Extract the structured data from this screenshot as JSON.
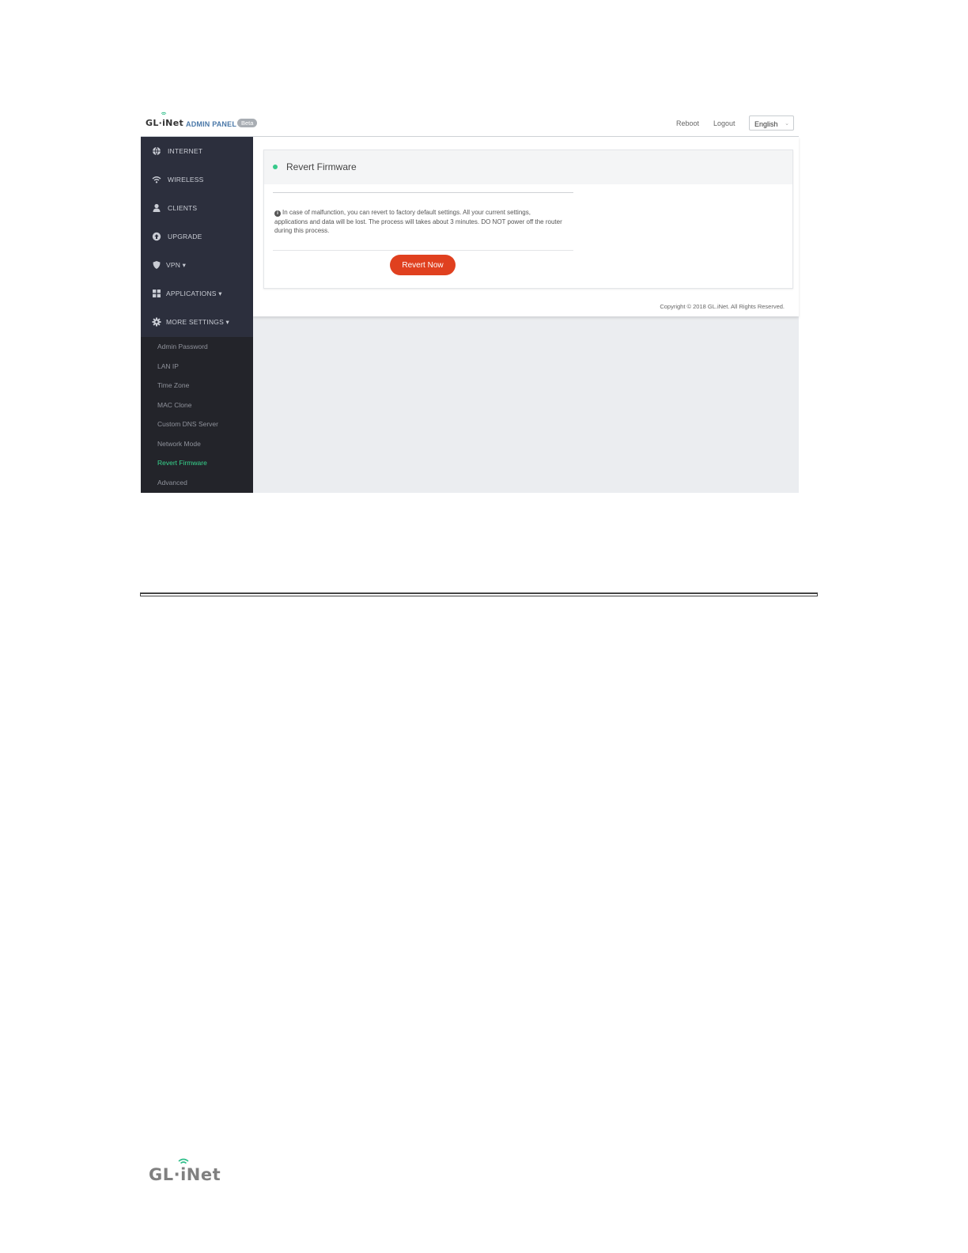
{
  "header": {
    "brand": "GL·iNet",
    "panel_label": "ADMIN PANEL",
    "badge": "Beta",
    "reboot": "Reboot",
    "logout": "Logout",
    "language": "English"
  },
  "sidebar": {
    "items": [
      {
        "label": "INTERNET",
        "icon": "globe-icon"
      },
      {
        "label": "WIRELESS",
        "icon": "wifi-icon"
      },
      {
        "label": "CLIENTS",
        "icon": "user-icon"
      },
      {
        "label": "UPGRADE",
        "icon": "upload-icon"
      },
      {
        "label": "VPN ▾",
        "icon": "shield-icon"
      },
      {
        "label": "APPLICATIONS ▾",
        "icon": "grid-icon"
      },
      {
        "label": "MORE SETTINGS ▾",
        "icon": "gear-icon"
      }
    ],
    "submenu": [
      {
        "label": "Admin Password"
      },
      {
        "label": "LAN IP"
      },
      {
        "label": "Time Zone"
      },
      {
        "label": "MAC Clone"
      },
      {
        "label": "Custom DNS Server"
      },
      {
        "label": "Network Mode"
      },
      {
        "label": "Revert Firmware",
        "active": true
      },
      {
        "label": "Advanced"
      }
    ]
  },
  "main": {
    "card_title": "Revert Firmware",
    "notice": "In case of malfunction, you can revert to factory default settings. All your current settings, applications and data will be lost. The process will takes about 3 minutes. DO NOT power off the router during this process.",
    "button": "Revert Now",
    "copyright": "Copyright © 2018 GL.iNet. All Rights Reserved."
  },
  "footer": {
    "logo": "GL·iNet"
  },
  "colors": {
    "accent_green": "#37d68e",
    "button_red": "#e0401f",
    "sidebar_bg": "#2c2f3d"
  }
}
